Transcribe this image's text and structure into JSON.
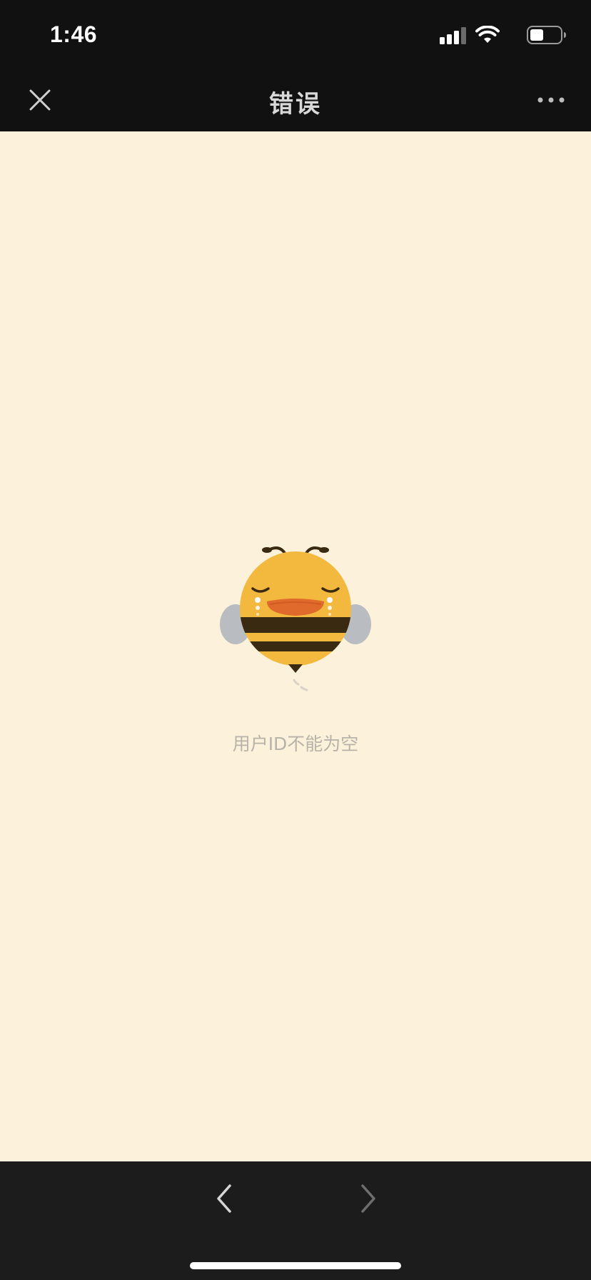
{
  "status_bar": {
    "time": "1:46",
    "icons": [
      "signal-icon",
      "wifi-icon",
      "battery-icon"
    ]
  },
  "nav_bar": {
    "title": "错误",
    "close_icon": "close-icon",
    "more_icon": "more-icon"
  },
  "content": {
    "illustration": "crying-bee-illustration",
    "message": "用户ID不能为空"
  },
  "bottom_bar": {
    "back_icon": "chevron-left-icon",
    "forward_icon": "chevron-right-icon"
  },
  "colors": {
    "bar_background": "#111111",
    "content_background": "#fcf1da",
    "bee_body": "#f3b93f",
    "bee_stripe": "#3a2a12",
    "bee_mouth": "#e0692c",
    "wing": "#b9bcc0",
    "message_text": "#b8b3a8"
  }
}
